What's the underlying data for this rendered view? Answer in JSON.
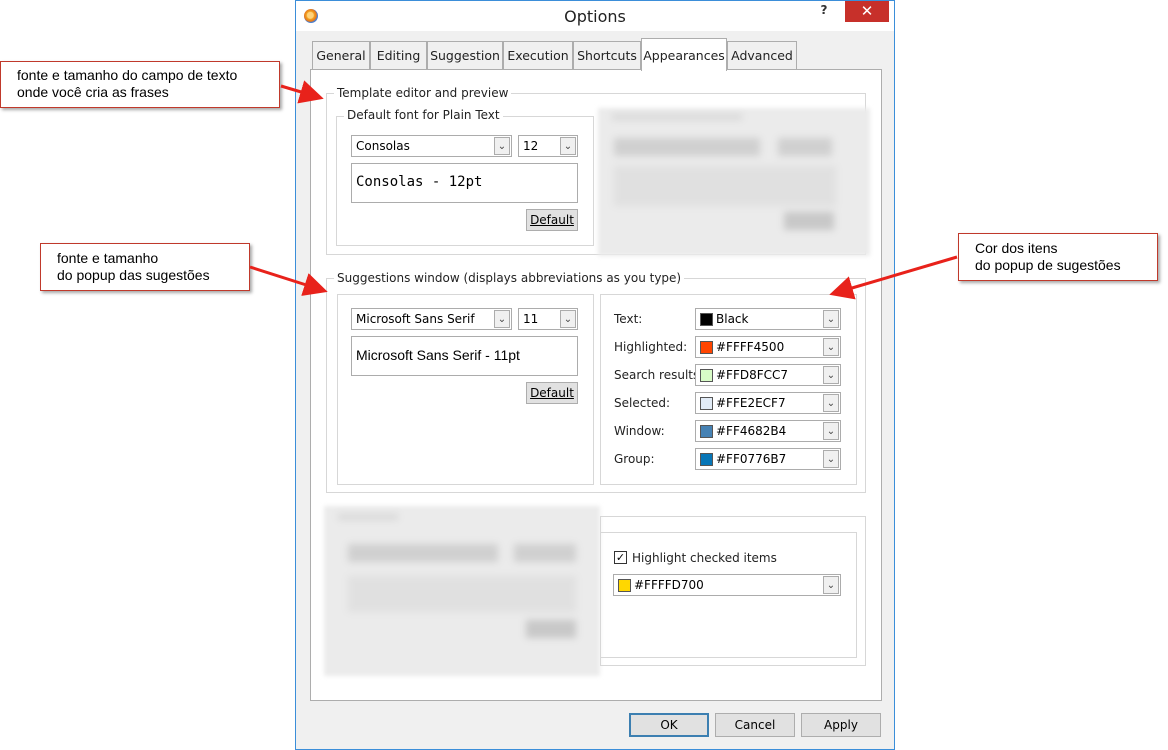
{
  "window": {
    "title": "Options",
    "help": "?",
    "close": "✕"
  },
  "tabs": [
    {
      "label": "General"
    },
    {
      "label": "Editing"
    },
    {
      "label": "Suggestion"
    },
    {
      "label": "Execution"
    },
    {
      "label": "Shortcuts"
    },
    {
      "label": "Appearances",
      "active": true
    },
    {
      "label": "Advanced"
    }
  ],
  "template_editor": {
    "legend": "Template editor and preview",
    "plain_text": {
      "legend": "Default font for Plain Text",
      "font": "Consolas",
      "size": "12",
      "preview": "Consolas - 12pt",
      "default_button": "Default"
    }
  },
  "suggestions_window": {
    "legend": "Suggestions window (displays abbreviations as you type)",
    "font": "Microsoft Sans Serif",
    "size": "11",
    "preview": "Microsoft Sans Serif - 11pt",
    "default_button": "Default",
    "colors": [
      {
        "label": "Text:",
        "value": "Black",
        "color": "#000000"
      },
      {
        "label": "Highlighted:",
        "value": "#FFFF4500",
        "color": "#FF4500"
      },
      {
        "label": "Search results:",
        "value": "#FFD8FCC7",
        "color": "#D8FCC7"
      },
      {
        "label": "Selected:",
        "value": "#FFE2ECF7",
        "color": "#E2ECF7"
      },
      {
        "label": "Window:",
        "value": "#FF4682B4",
        "color": "#4682B4"
      },
      {
        "label": "Group:",
        "value": "#FF0776B7",
        "color": "#0776B7"
      }
    ]
  },
  "highlight": {
    "checkbox_label": "Highlight checked items",
    "checked": true,
    "color_value": "#FFFFD700",
    "color": "#FFD700"
  },
  "footer": {
    "ok": "OK",
    "cancel": "Cancel",
    "apply": "Apply"
  },
  "callouts": {
    "template": [
      "fonte e tamanho do campo de texto",
      "onde você cria as frases"
    ],
    "popup": [
      "fonte e tamanho",
      "do popup das sugestões"
    ],
    "colors": [
      "Cor dos itens",
      "do popup de sugestões"
    ]
  },
  "annotation_color": "#E8221B"
}
